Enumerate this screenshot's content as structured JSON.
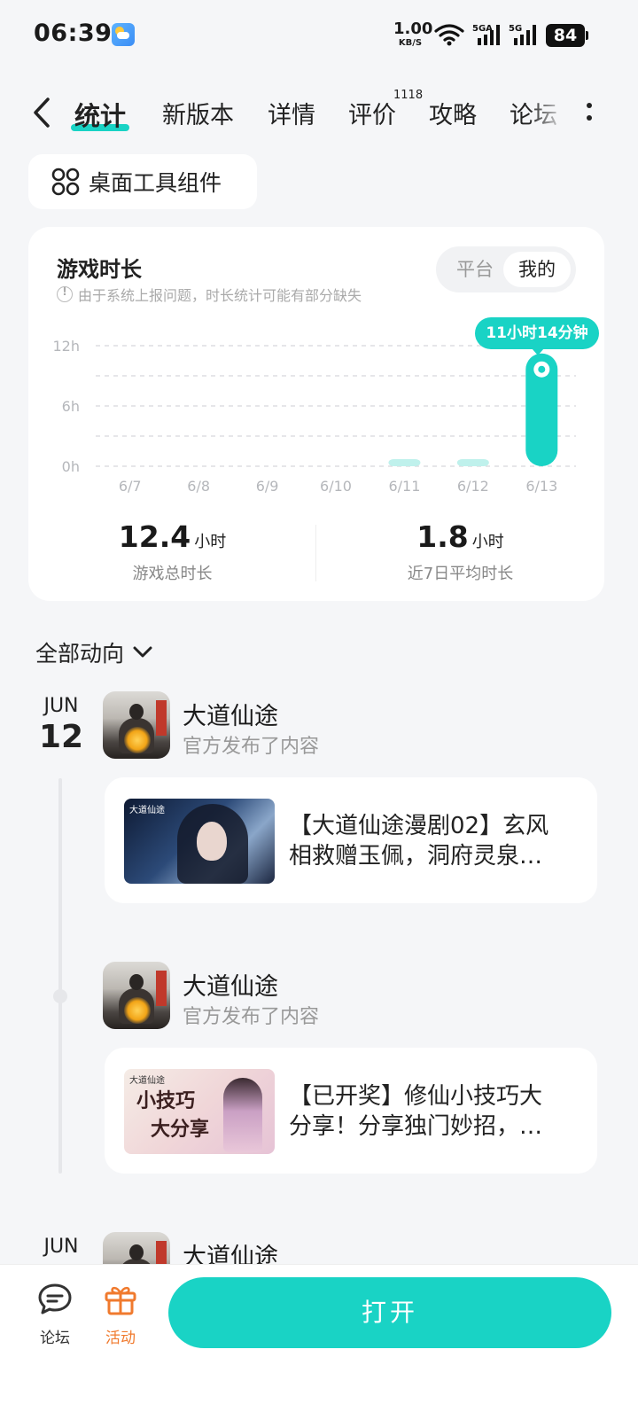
{
  "status_bar": {
    "time": "06:39",
    "speed_value": "1.00",
    "speed_unit": "KB/S",
    "sig1_label": "5GA",
    "sig2_label": "5G",
    "battery": "84"
  },
  "tabs": [
    {
      "label": "统计",
      "active": true
    },
    {
      "label": "新版本"
    },
    {
      "label": "详情"
    },
    {
      "label": "评价",
      "badge": "1118"
    },
    {
      "label": "攻略"
    },
    {
      "label": "论坛"
    }
  ],
  "widget_chip": {
    "label": "桌面工具组件"
  },
  "play_time": {
    "title": "游戏时长",
    "note": "由于系统上报问题，时长统计可能有部分缺失",
    "segment": {
      "options": [
        "平台",
        "我的"
      ],
      "selected": "我的"
    },
    "tooltip": "11小时14分钟",
    "total": {
      "value": "12.4",
      "unit": "小时",
      "label": "游戏总时长"
    },
    "average": {
      "value": "1.8",
      "unit": "小时",
      "label": "近7日平均时长"
    }
  },
  "chart_data": {
    "type": "bar",
    "categories": [
      "6/7",
      "6/8",
      "6/9",
      "6/10",
      "6/11",
      "6/12",
      "6/13"
    ],
    "values": [
      0,
      0,
      0,
      0,
      0.4,
      0.4,
      11.23
    ],
    "yticks": [
      "0h",
      "6h",
      "12h"
    ],
    "ylim": [
      0,
      12
    ],
    "grid": true,
    "colors": {
      "bar": "#19d3c5",
      "bar_light": "#bff1ec"
    }
  },
  "feed": {
    "filter_label": "全部动向",
    "groups": [
      {
        "month": "JUN",
        "day": "12",
        "posts": [
          {
            "author": "大道仙途",
            "action": "官方发布了内容",
            "line1": "【大道仙途漫剧02】玄风",
            "line2": "相救赠玉佩，洞府灵泉…",
            "thumb_logo": "大道仙途"
          },
          {
            "author": "大道仙途",
            "action": "官方发布了内容",
            "line1": "【已开奖】修仙小技巧大",
            "line2": "分享！分享独门妙招，…",
            "thumb_logo": "大道仙途",
            "thumb_title1": "小技巧",
            "thumb_title2": "大分享"
          }
        ]
      },
      {
        "month": "JUN",
        "posts": [
          {
            "author": "大道仙途"
          }
        ]
      }
    ]
  },
  "bottom_bar": {
    "forum_label": "论坛",
    "activity_label": "活动",
    "open_label": "打开"
  },
  "colors": {
    "accent": "#19d3c5",
    "activity": "#f07a2e"
  }
}
